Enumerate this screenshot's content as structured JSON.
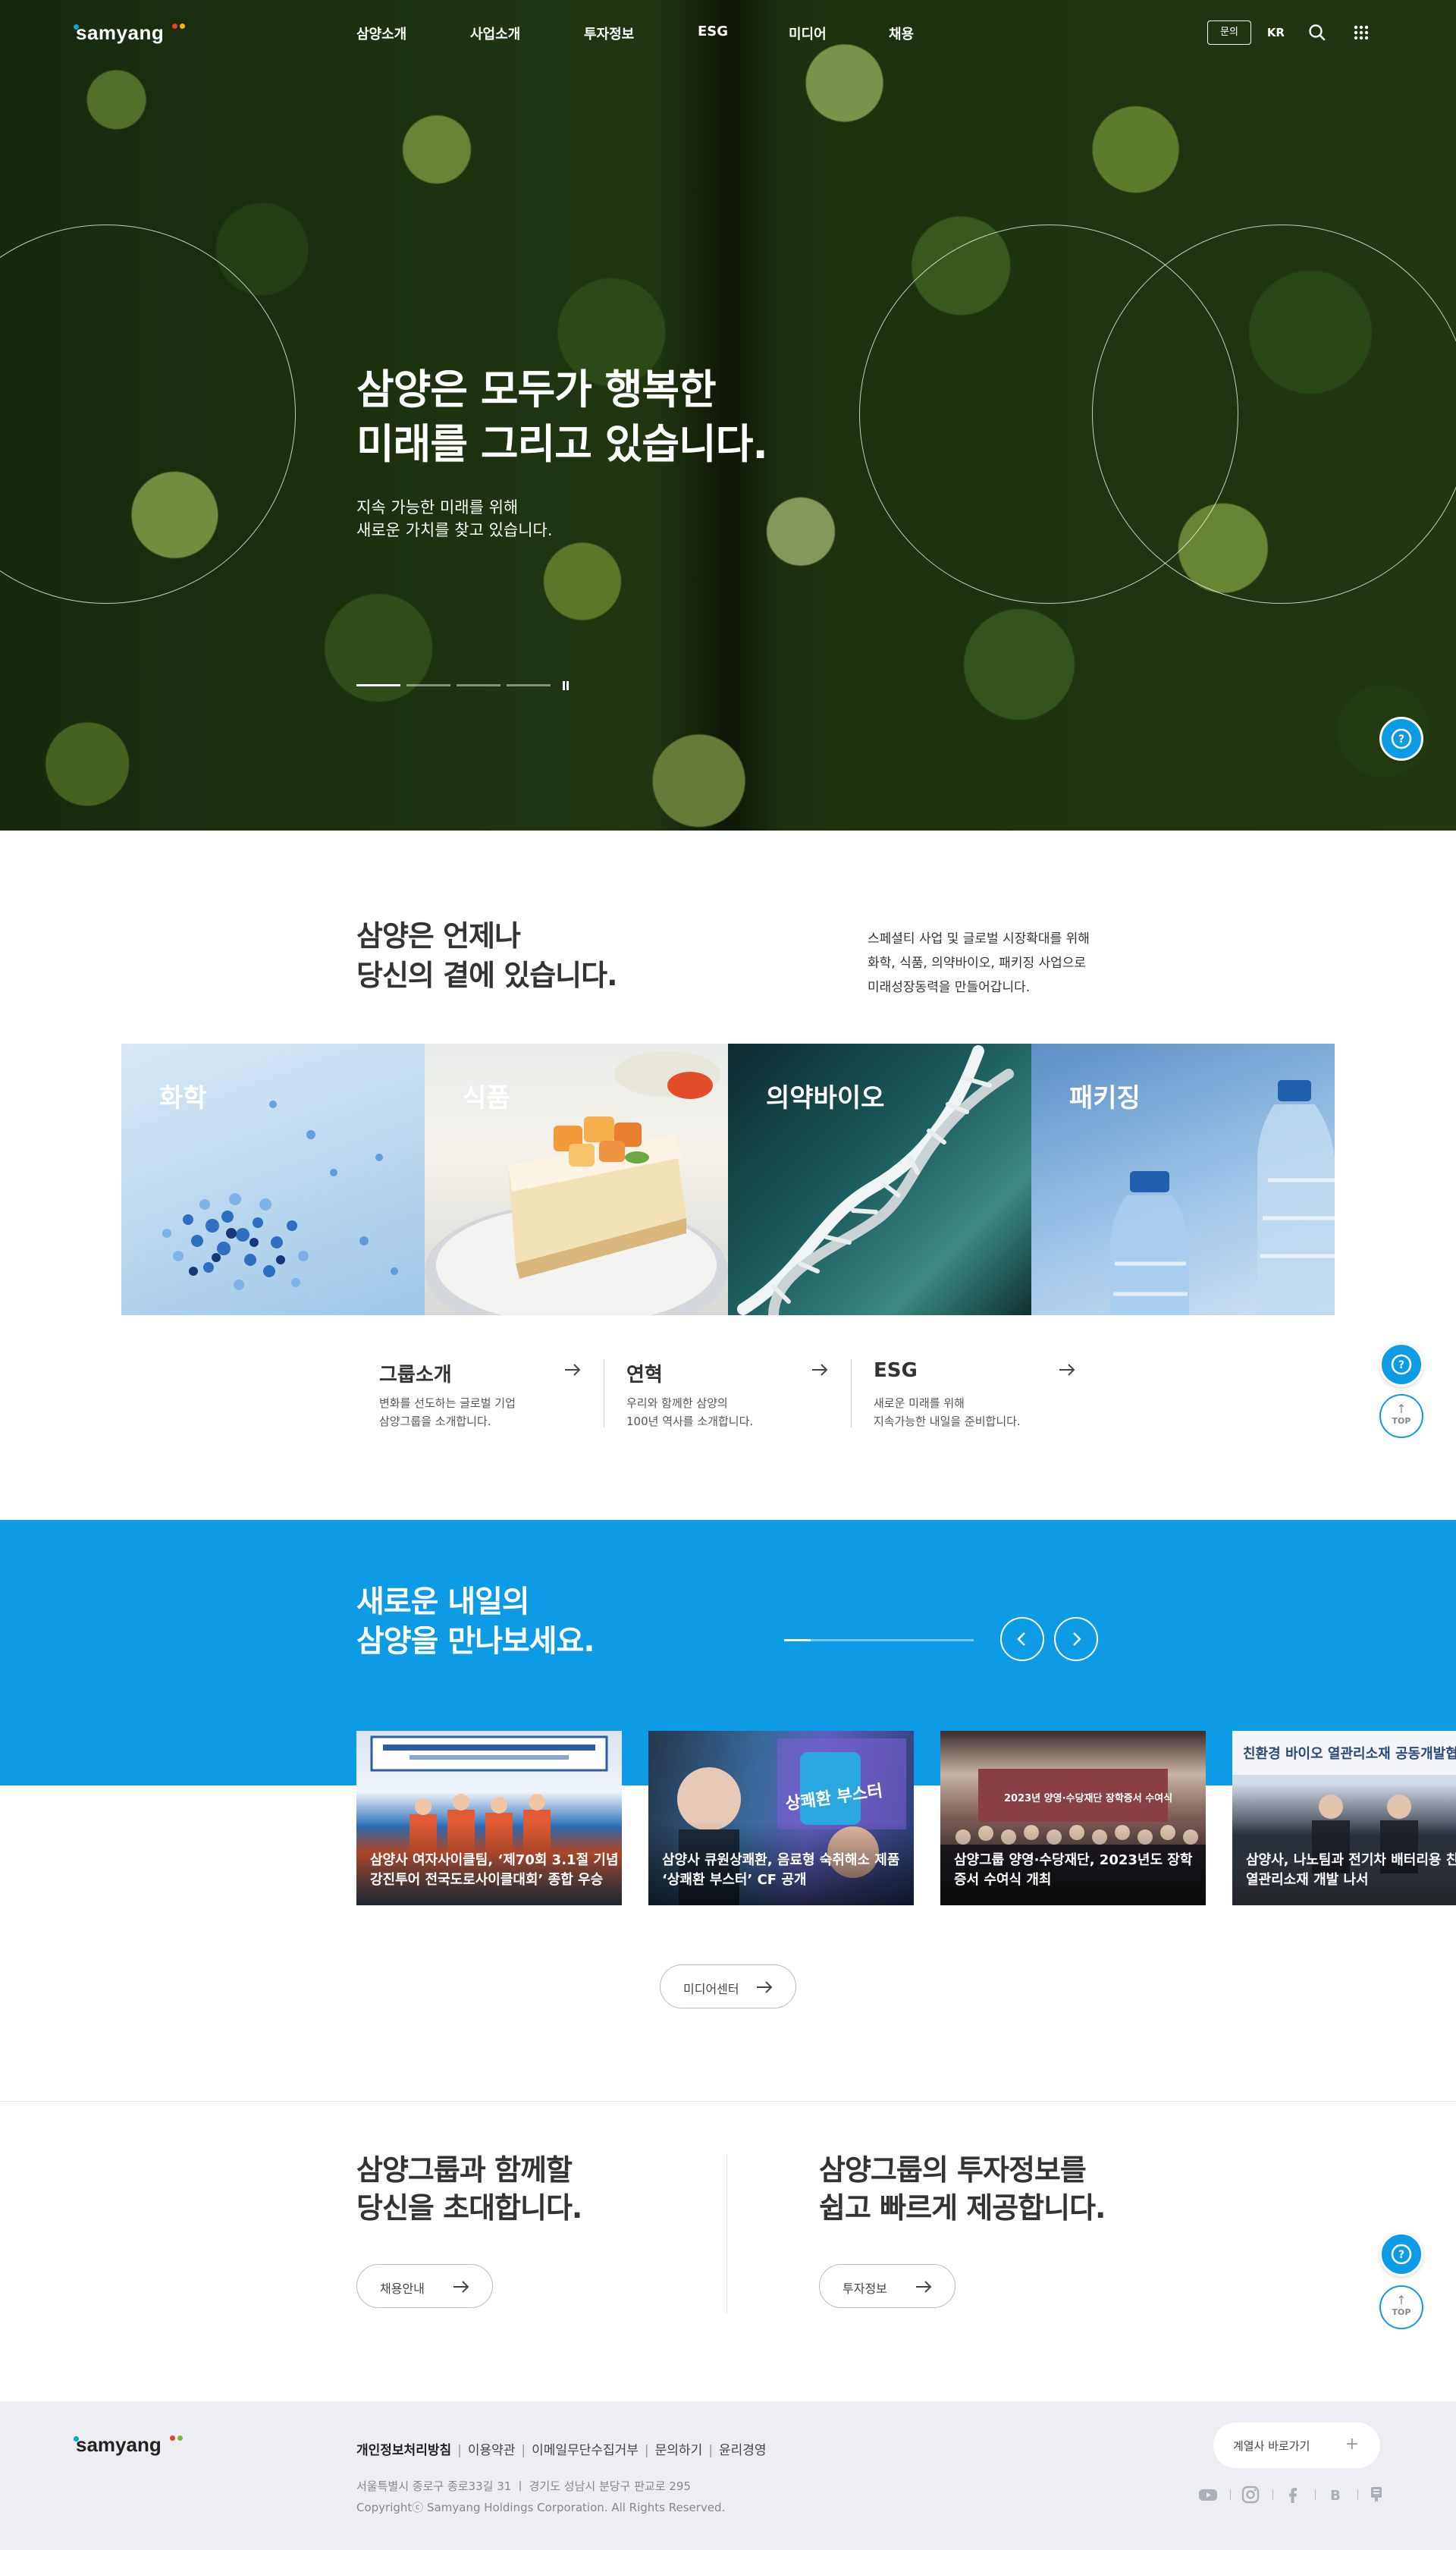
{
  "brand": {
    "name": "samyang",
    "colors": {
      "accent": "#0d9be6",
      "dot_blue": "#00a7e1",
      "dot_red": "#e8412c",
      "dot_yellow": "#f5b800",
      "dot_green": "#7dbb37"
    }
  },
  "header": {
    "nav": [
      "삼양소개",
      "사업소개",
      "투자정보",
      "ESG",
      "미디어",
      "채용"
    ],
    "inquiry_label": "문의",
    "lang_label": "KR",
    "icons": [
      "search-icon",
      "grid-menu-icon"
    ]
  },
  "hero": {
    "title_line1": "삼양은 모두가 행복한",
    "title_line2": "미래를 그리고 있습니다.",
    "sub_line1": "지속 가능한 미래를 위해",
    "sub_line2": "새로운 가치를 찾고 있습니다.",
    "slide_count": 4,
    "active_slide": 1
  },
  "intro": {
    "title_line1": "삼양은 언제나",
    "title_line2": "당신의 곁에 있습니다.",
    "desc_line1": "스페셜티 사업 및 글로벌 시장확대를 위해",
    "desc_line2": "화학, 식품, 의약바이오, 패키징 사업으로",
    "desc_line3": "미래성장동력을 만들어갑니다."
  },
  "business": [
    {
      "label": "화학"
    },
    {
      "label": "식품"
    },
    {
      "label": "의약바이오"
    },
    {
      "label": "패키징"
    }
  ],
  "quick_links": [
    {
      "title": "그룹소개",
      "desc_line1": "변화를 선도하는 글로벌 기업",
      "desc_line2": "삼양그룹을 소개합니다."
    },
    {
      "title": "연혁",
      "desc_line1": "우리와 함께한 삼양의",
      "desc_line2": "100년 역사를 소개합니다."
    },
    {
      "title": "ESG",
      "desc_line1": "새로운 미래를 위해",
      "desc_line2": "지속가능한 내일을 준비합니다."
    }
  ],
  "media": {
    "title_line1": "새로운 내일의",
    "title_line2": "삼양을 만나보세요.",
    "progress_fraction": 0.14,
    "prev_label": "‹",
    "next_label": "›",
    "news": [
      {
        "caption_line1": "삼양사 여자사이클팀, ‘제70회 3.1절 기념",
        "caption_line2": "강진투어 전국도로사이클대회’ 종합 우승"
      },
      {
        "caption_line1": "삼양사 큐원상쾌환, 음료형 숙취해소 제품",
        "caption_line2": "‘상쾌환 부스터’ CF 공개",
        "badge": "상쾌환 부스터"
      },
      {
        "caption_line1": "삼양그룹 양영·수당재단, 2023년도 장학",
        "caption_line2": "증서 수여식 개최",
        "banner": "2023년 양영·수당재단 장학증서 수여식"
      },
      {
        "caption_line1": "삼양사, 나노팀과 전기차 배터리용 친",
        "caption_line2": "열관리소재 개발 나서",
        "banner": "친환경 바이오 열관리소재 공동개발협"
      }
    ],
    "center_label": "미디어센터"
  },
  "invite": {
    "left": {
      "title_line1": "삼양그룹과 함께할",
      "title_line2": "당신을 초대합니다.",
      "button": "채용안내"
    },
    "right": {
      "title_line1": "삼양그룹의 투자정보를",
      "title_line2": "쉽고 빠르게 제공합니다.",
      "button": "투자정보"
    }
  },
  "floating": {
    "top_label": "TOP",
    "top_arrow": "↑",
    "help_icon": "question-icon"
  },
  "footer": {
    "links": [
      "개인정보처리방침",
      "이용약관",
      "이메일무단수집거부",
      "문의하기",
      "윤리경영"
    ],
    "separator": "|",
    "address": "서울특별시 종로구 종로33길 31 ㅣ 경기도 성남시 분당구 판교로 295",
    "copyright": "Copyrightⓒ Samyang Holdings Corporation. All Rights Reserved.",
    "family_label": "계열사 바로가기",
    "family_plus": "+",
    "sns": [
      "youtube-icon",
      "instagram-icon",
      "facebook-icon",
      "blog-icon",
      "post-icon"
    ]
  }
}
